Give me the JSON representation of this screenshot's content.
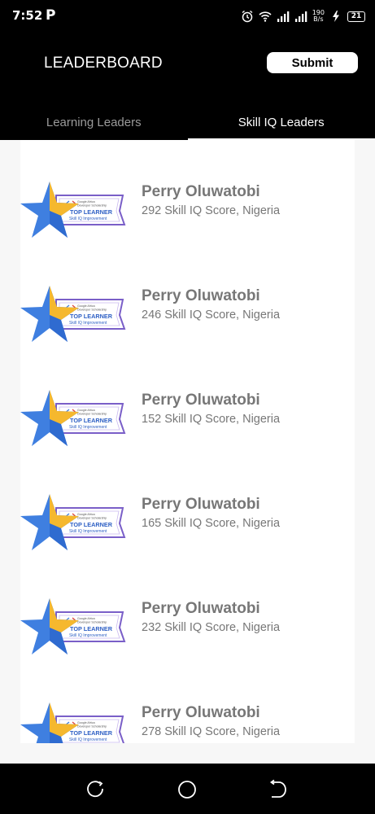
{
  "status_bar": {
    "time": "7:52",
    "app_indicator": "P",
    "net_speed_value": "190",
    "net_speed_unit": "B/s",
    "battery": "21"
  },
  "header": {
    "title": "LEADERBOARD",
    "submit_label": "Submit"
  },
  "tabs": [
    {
      "label": "Learning Leaders",
      "active": false
    },
    {
      "label": "Skill IQ Leaders",
      "active": true
    }
  ],
  "badge": {
    "line1": "Google Africa",
    "line2": "Developer Scholarship",
    "title": "TOP LEARNER",
    "subtitle": "Skill IQ Improvement",
    "colors": {
      "star_blue": "#3f7fe0",
      "star_gold": "#f5b82e",
      "ribbon_border": "#7a5fc8",
      "text_blue": "#2d5fc4"
    }
  },
  "leaders": [
    {
      "name": "Perry Oluwatobi",
      "detail": "292 Skill IQ Score, Nigeria"
    },
    {
      "name": "Perry Oluwatobi",
      "detail": "246 Skill IQ Score, Nigeria"
    },
    {
      "name": "Perry Oluwatobi",
      "detail": "152 Skill IQ Score, Nigeria"
    },
    {
      "name": "Perry Oluwatobi",
      "detail": "165 Skill IQ Score, Nigeria"
    },
    {
      "name": "Perry Oluwatobi",
      "detail": "232 Skill IQ Score, Nigeria"
    },
    {
      "name": "Perry Oluwatobi",
      "detail": "278 Skill IQ Score, Nigeria"
    }
  ],
  "nav": {
    "icons": [
      "recent-apps-icon",
      "home-icon",
      "back-icon"
    ]
  }
}
